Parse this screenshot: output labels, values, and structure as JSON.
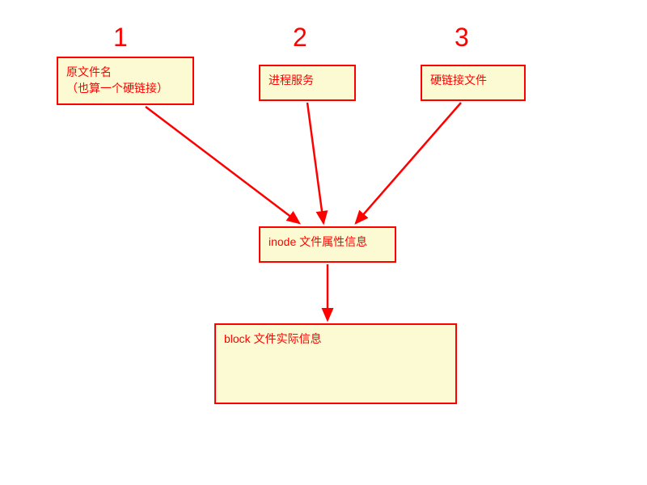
{
  "labels": {
    "one": "1",
    "two": "2",
    "three": "3"
  },
  "boxes": {
    "original": {
      "line1": "原文件名",
      "line2": "（也算一个硬链接）"
    },
    "process": "进程服务",
    "hardlink": "硬链接文件",
    "inode": "inode 文件属性信息",
    "block": "block 文件实际信息"
  },
  "chart_data": {
    "type": "diagram",
    "nodes": [
      {
        "id": "original",
        "label": "原文件名（也算一个硬链接）",
        "number": 1
      },
      {
        "id": "process",
        "label": "进程服务",
        "number": 2
      },
      {
        "id": "hardlink",
        "label": "硬链接文件",
        "number": 3
      },
      {
        "id": "inode",
        "label": "inode 文件属性信息"
      },
      {
        "id": "block",
        "label": "block 文件实际信息"
      }
    ],
    "edges": [
      {
        "from": "original",
        "to": "inode"
      },
      {
        "from": "process",
        "to": "inode"
      },
      {
        "from": "hardlink",
        "to": "inode"
      },
      {
        "from": "inode",
        "to": "block"
      }
    ]
  },
  "colors": {
    "stroke": "#ff0000",
    "fill": "#fcfad2"
  }
}
